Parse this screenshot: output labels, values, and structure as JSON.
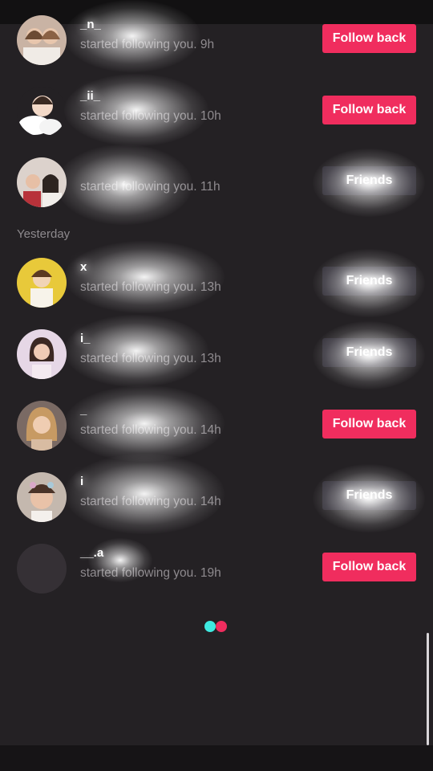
{
  "notifications": [
    {
      "username": "_n_",
      "activity": "started following you. 9h",
      "button": "Follow back",
      "button_type": "follow",
      "avatar": "two-girls-avatar"
    },
    {
      "username": "_ii_",
      "activity": "started following you. 10h",
      "button": "Follow back",
      "button_type": "follow",
      "avatar": "cartoon-avatar"
    },
    {
      "username": "",
      "activity": "started following you. 11h",
      "button": "Friends",
      "button_type": "friends",
      "avatar": "two-people-avatar"
    }
  ],
  "section_label": "Yesterday",
  "yesterday": [
    {
      "username": "x",
      "activity": "started following you. 13h",
      "button": "Friends",
      "button_type": "friends",
      "avatar": "yellow-avatar"
    },
    {
      "username": "i_",
      "activity": "started following you. 13h",
      "button": "Friends",
      "button_type": "friends",
      "avatar": "dark-hair-girl-avatar"
    },
    {
      "username": "_",
      "activity": "started following you. 14h",
      "button": "Follow back",
      "button_type": "follow",
      "avatar": "blonde-girl-avatar"
    },
    {
      "username": "i",
      "activity": "started following you. 14h",
      "button": "Friends",
      "button_type": "friends",
      "avatar": "child-avatar"
    },
    {
      "username": "__.a",
      "activity": "started following you. 19h",
      "button": "Follow back",
      "button_type": "follow",
      "avatar": "empty-avatar"
    }
  ],
  "colors": {
    "follow_button": "#f02d5e",
    "friends_button": "#34313a",
    "background": "#242124",
    "loader_cyan": "#3ee9e0",
    "loader_pink": "#f02d5e"
  }
}
